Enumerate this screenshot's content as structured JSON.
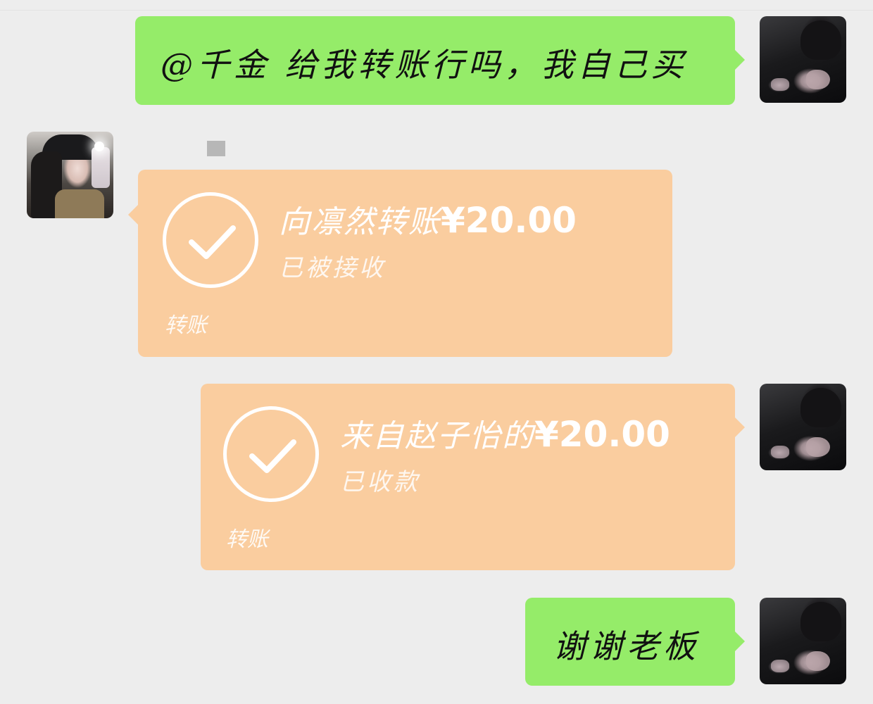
{
  "chat": {
    "messages": [
      {
        "id": "m1",
        "side": "right",
        "type": "text",
        "text": "@千金 给我转账行吗，我自己买"
      },
      {
        "id": "m2",
        "side": "left",
        "type": "transfer",
        "title_name": "向凛然转账",
        "amount": "¥20.00",
        "status": "已被接收",
        "footer": "转账"
      },
      {
        "id": "m3",
        "side": "right",
        "type": "transfer",
        "title_name": "来自赵子怡的",
        "amount": "¥20.00",
        "status": "已收款",
        "footer": "转账"
      },
      {
        "id": "m4",
        "side": "right",
        "type": "text",
        "text": "谢谢老板"
      }
    ]
  },
  "colors": {
    "background": "#ededed",
    "self_bubble": "#95ec69",
    "transfer_card": "#facd9f",
    "transfer_text": "#ffffff"
  },
  "icons": {
    "check": "check-circle-icon"
  }
}
